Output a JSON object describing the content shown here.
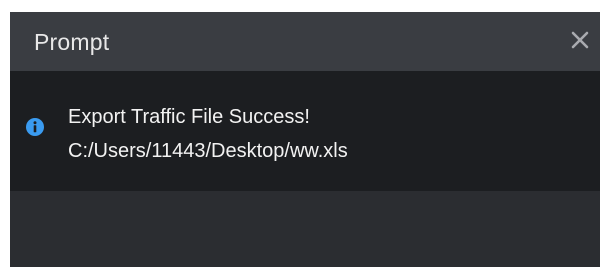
{
  "dialog": {
    "title": "Prompt",
    "close_icon": "close-icon",
    "info_icon": "info-icon",
    "accent_color": "#3a9bf0",
    "message": {
      "line1": "Export Traffic File Success!",
      "line2": "C:/Users/11443/Desktop/ww.xls"
    }
  }
}
